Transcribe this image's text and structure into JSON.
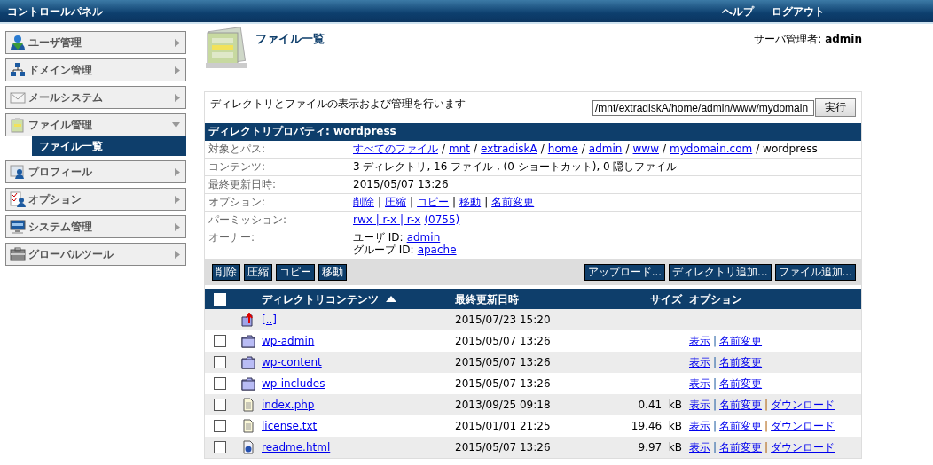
{
  "header": {
    "title": "コントロールパネル",
    "links": [
      "ヘルプ",
      "ログアウト"
    ]
  },
  "sidebar": {
    "items": [
      {
        "label": "ユーザ管理",
        "expanded": false
      },
      {
        "label": "ドメイン管理",
        "expanded": false
      },
      {
        "label": "メールシステム",
        "expanded": false
      },
      {
        "label": "ファイル管理",
        "expanded": true,
        "children": [
          {
            "label": "ファイル一覧",
            "selected": true
          }
        ]
      },
      {
        "label": "プロフィール",
        "expanded": false
      },
      {
        "label": "オプション",
        "expanded": false
      },
      {
        "label": "システム管理",
        "expanded": false
      },
      {
        "label": "グローバルツール",
        "expanded": false
      }
    ]
  },
  "page": {
    "title": "ファイル一覧",
    "user": "サーバ管理者: **admin**"
  },
  "intro": {
    "text": "ディレクトリとファイルの表示および管理を行います",
    "path_field": "/mnt/extradiskA/home/admin/www/mydomain",
    "run_button": "実行"
  },
  "properties": {
    "title": "ディレクトリプロパティ: wordpress",
    "rows": [
      {
        "label": "対象とパス:",
        "lines": [
          [
            {
              "text": "すべてのファイル",
              "link": true
            },
            {
              "text": "/",
              "link": false
            },
            {
              "text": "mnt",
              "link": true
            },
            {
              "text": "/",
              "link": false
            },
            {
              "text": "extradiskA",
              "link": true
            },
            {
              "text": "/",
              "link": false
            },
            {
              "text": "home",
              "link": true
            },
            {
              "text": "/",
              "link": false
            },
            {
              "text": "admin",
              "link": true
            },
            {
              "text": "/",
              "link": false
            },
            {
              "text": "www",
              "link": true
            },
            {
              "text": "/",
              "link": false
            },
            {
              "text": "mydomain.com",
              "link": true
            },
            {
              "text": "/ wordpress",
              "link": false
            }
          ]
        ]
      },
      {
        "label": "コンテンツ:",
        "lines": [
          [
            {
              "text": "3 ディレクトリ, 16 ファイル , (0 ショートカット), 0 隠しファイル",
              "link": false
            }
          ]
        ]
      },
      {
        "label": "最終更新日時:",
        "lines": [
          [
            {
              "text": "2015/05/07 13:26",
              "link": false
            }
          ]
        ]
      },
      {
        "label": "オプション:",
        "lines": [
          [
            {
              "text": "削除",
              "link": true
            },
            {
              "text": "|",
              "link": false
            },
            {
              "text": "圧縮",
              "link": true
            },
            {
              "text": "|",
              "link": false
            },
            {
              "text": "コピー",
              "link": true
            },
            {
              "text": "|",
              "link": false
            },
            {
              "text": "移動",
              "link": true
            },
            {
              "text": "|",
              "link": false
            },
            {
              "text": "名前変更",
              "link": true
            }
          ]
        ]
      },
      {
        "label": "パーミッション:",
        "lines": [
          [
            {
              "text": "rwx | r-x | r-x",
              "link": true
            },
            {
              "text": "(0755)",
              "link": true
            }
          ]
        ]
      },
      {
        "label": "オーナー:",
        "lines": [
          [
            {
              "text": "ユーザ ID:",
              "link": false
            },
            {
              "text": "admin",
              "link": true
            }
          ],
          [
            {
              "text": "グループ ID:",
              "link": false
            },
            {
              "text": "apache",
              "link": true
            }
          ]
        ]
      }
    ]
  },
  "toolbar": {
    "left": [
      "削除",
      "圧縮",
      "コピー",
      "移動"
    ],
    "right": [
      "アップロード...",
      "ディレクトリ追加...",
      "ファイル追加..."
    ]
  },
  "table": {
    "select_all": {
      "checked": false
    },
    "columns": [
      "ディレクトリコンテンツ",
      "最終更新日時",
      "サイズ",
      "オプション"
    ],
    "rows": [
      {
        "kind": "parent",
        "name": "[..]",
        "modified": "2015/07/23 15:20",
        "options": []
      },
      {
        "kind": "folder",
        "checked": false,
        "name": "wp-admin",
        "modified": "2015/05/07 13:26",
        "options": [
          "表示",
          "|",
          "名前変更"
        ]
      },
      {
        "kind": "folder",
        "checked": false,
        "name": "wp-content",
        "modified": "2015/05/07 13:26",
        "options": [
          "表示",
          "|",
          "名前変更"
        ]
      },
      {
        "kind": "folder",
        "checked": false,
        "name": "wp-includes",
        "modified": "2015/05/07 13:26",
        "options": [
          "表示",
          "|",
          "名前変更"
        ]
      },
      {
        "kind": "file",
        "checked": false,
        "name": "index.php",
        "modified": "2013/09/25 09:18",
        "size": "0.41  kB",
        "options": [
          "表示",
          "|",
          "名前変更",
          "|",
          "ダウンロード"
        ]
      },
      {
        "kind": "file",
        "checked": false,
        "name": "license.txt",
        "modified": "2015/01/01 21:25",
        "size": "19.46  kB",
        "options": [
          "表示",
          "|",
          "名前変更",
          "|",
          "ダウンロード"
        ]
      },
      {
        "kind": "web",
        "checked": false,
        "name": "readme.html",
        "modified": "2015/05/07 13:26",
        "size": "9.97  kB",
        "options": [
          "表示",
          "|",
          "名前変更",
          "|",
          "ダウンロード"
        ]
      }
    ]
  }
}
